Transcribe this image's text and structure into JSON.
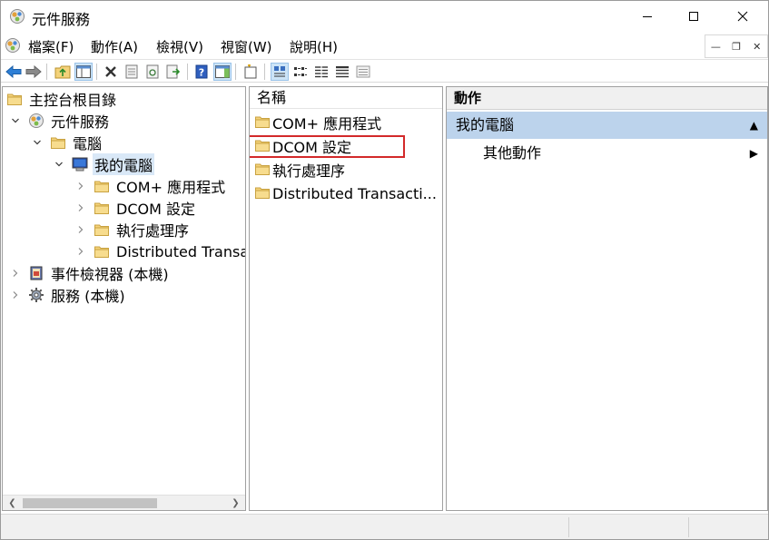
{
  "window": {
    "title": "元件服務",
    "controls": {
      "minimize": "minimize-icon",
      "maximize": "maximize-icon",
      "close": "close-icon"
    }
  },
  "menubar": {
    "items": [
      {
        "label": "檔案(F)"
      },
      {
        "label": "動作(A)"
      },
      {
        "label": "檢視(V)"
      },
      {
        "label": "視窗(W)"
      },
      {
        "label": "說明(H)"
      }
    ]
  },
  "toolbar": {
    "buttons": [
      "back-arrow-icon",
      "forward-arrow-icon",
      "up-folder-icon",
      "show-hide-tree-icon",
      "delete-icon",
      "properties-icon",
      "refresh-icon",
      "export-list-icon",
      "help-icon",
      "show-hide-action-pane-icon",
      "new-window-icon",
      "large-icons-view-icon",
      "small-icons-view-icon",
      "list-view-icon",
      "detail-view-icon",
      "configure-icon"
    ]
  },
  "tree": {
    "items": [
      {
        "label": "主控台根目錄",
        "level": 0,
        "expanded": true,
        "icon": "folder-icon"
      },
      {
        "label": "元件服務",
        "level": 1,
        "expanded": true,
        "icon": "component-services-icon"
      },
      {
        "label": "電腦",
        "level": 2,
        "expanded": true,
        "icon": "folder-icon"
      },
      {
        "label": "我的電腦",
        "level": 3,
        "expanded": true,
        "icon": "my-computer-icon",
        "selected": true
      },
      {
        "label": "COM+ 應用程式",
        "level": 4,
        "expanded": false,
        "icon": "folder-icon"
      },
      {
        "label": "DCOM 設定",
        "level": 4,
        "expanded": false,
        "icon": "folder-icon"
      },
      {
        "label": "執行處理序",
        "level": 4,
        "expanded": false,
        "icon": "folder-icon"
      },
      {
        "label": "Distributed Transa",
        "level": 4,
        "expanded": false,
        "icon": "folder-icon"
      },
      {
        "label": "事件檢視器 (本機)",
        "level": 1,
        "expanded": false,
        "icon": "event-viewer-icon"
      },
      {
        "label": "服務 (本機)",
        "level": 1,
        "expanded": false,
        "icon": "services-gear-icon"
      }
    ]
  },
  "list": {
    "header": "名稱",
    "items": [
      {
        "label": "COM+ 應用程式"
      },
      {
        "label": "DCOM 設定",
        "highlighted": true
      },
      {
        "label": "執行處理序"
      },
      {
        "label": "Distributed Transacti..."
      }
    ]
  },
  "actions": {
    "title": "動作",
    "group": "我的電腦",
    "items": [
      {
        "label": "其他動作"
      }
    ]
  },
  "colors": {
    "selection": "#d9e8f7",
    "action_group": "#bcd3ec",
    "highlight_border": "#d3292a",
    "folder": "#f4d27a"
  }
}
